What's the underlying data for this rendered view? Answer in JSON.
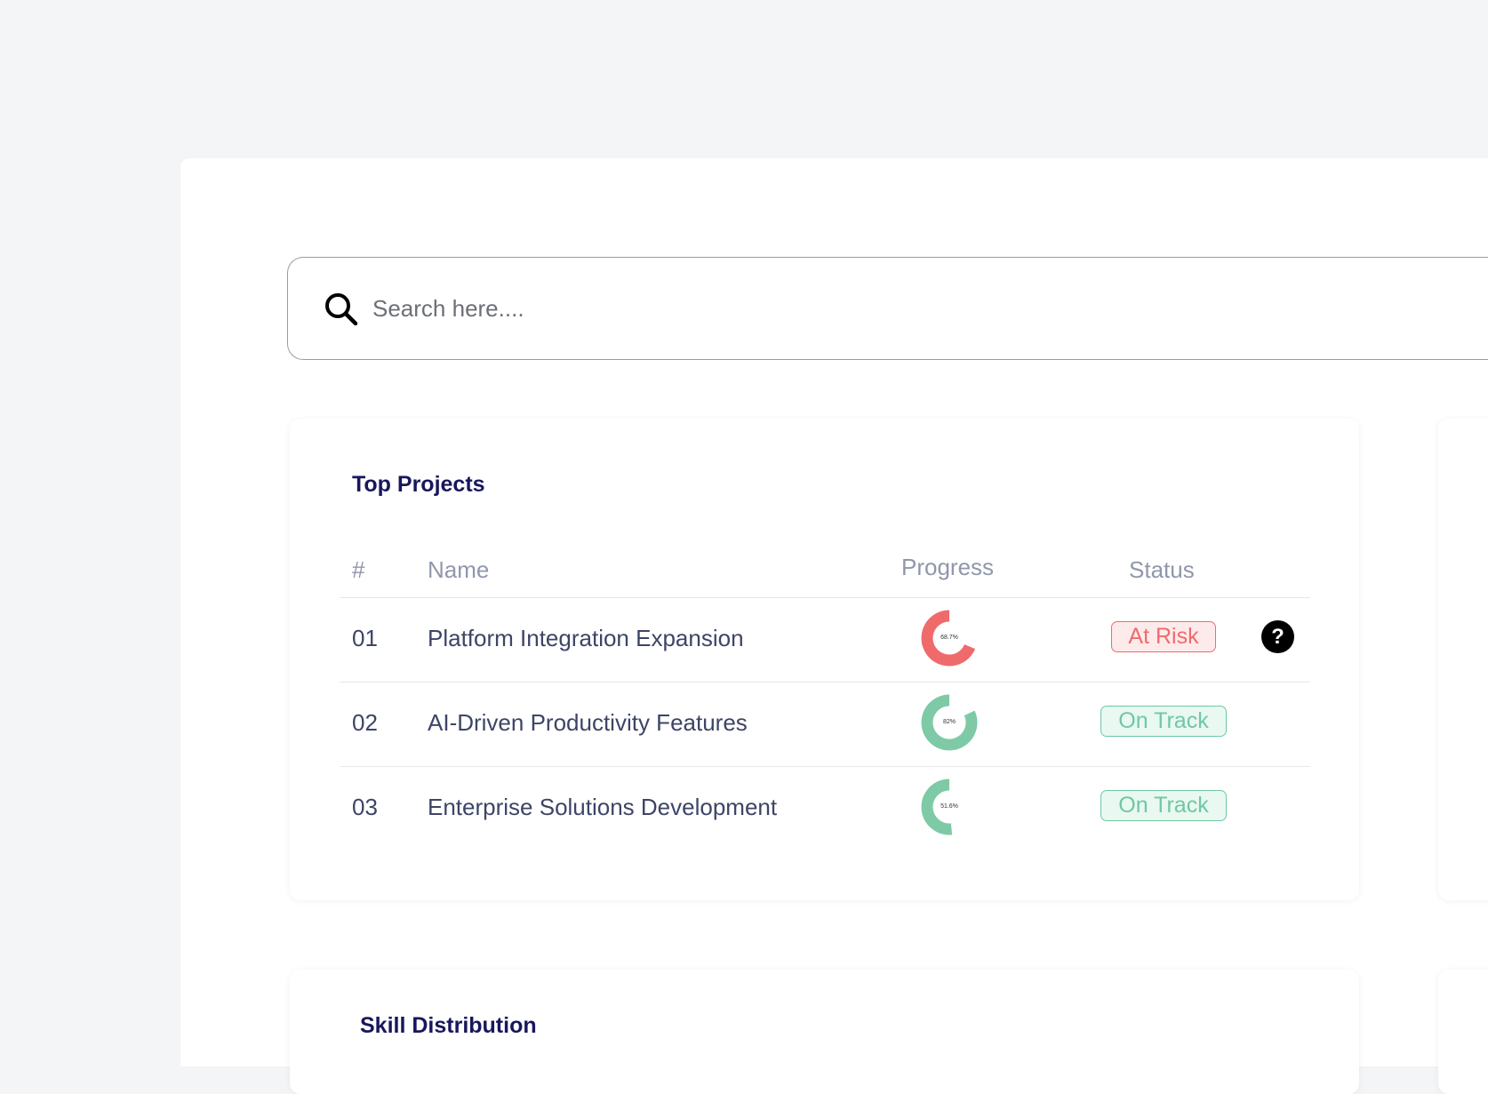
{
  "search": {
    "placeholder": "Search here...."
  },
  "top_projects": {
    "title": "Top Projects",
    "columns": {
      "num": "#",
      "name": "Name",
      "progress": "Progress",
      "status": "Status"
    },
    "rows": [
      {
        "num": "01",
        "name": "Platform Integration Expansion",
        "progress": 68.7,
        "progress_label": "68.7%",
        "status": "At Risk",
        "status_type": "risk",
        "color": "#ef6b6b"
      },
      {
        "num": "02",
        "name": "AI-Driven Productivity Features",
        "progress": 82,
        "progress_label": "82%",
        "status": "On Track",
        "status_type": "track",
        "color": "#7fcaa6"
      },
      {
        "num": "03",
        "name": "Enterprise Solutions Development",
        "progress": 51.6,
        "progress_label": "51.6%",
        "status": "On Track",
        "status_type": "track",
        "color": "#7fcaa6"
      }
    ],
    "help_icon": "question-mark-icon"
  },
  "skill_distribution": {
    "title": "Skill Distribution"
  },
  "colors": {
    "title": "#18175c",
    "risk": "#ef6b6b",
    "track": "#6fc8a3",
    "background": "#f4f5f7"
  }
}
